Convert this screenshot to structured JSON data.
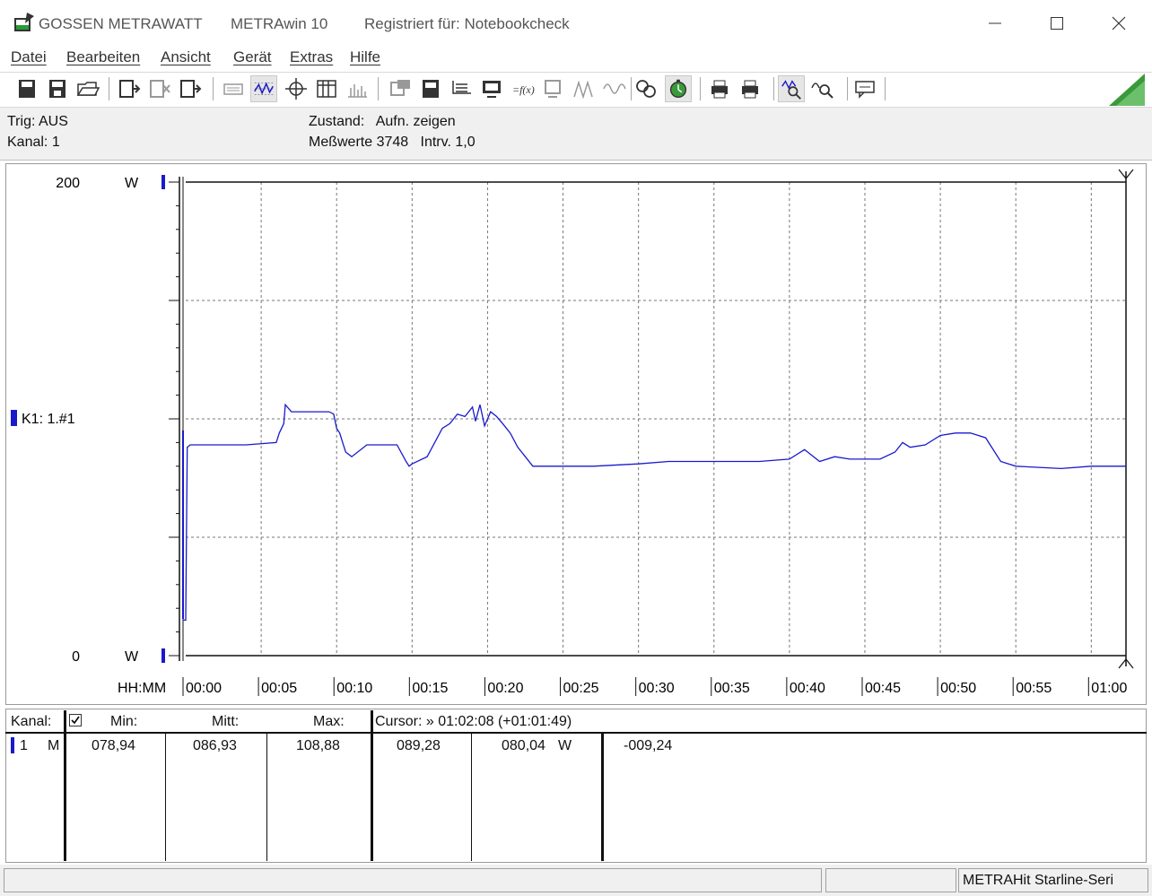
{
  "window": {
    "company": "GOSSEN METRAWATT",
    "app_name": "METRAwin 10",
    "registered": "Registriert für: Notebookcheck"
  },
  "menu": [
    "Datei",
    "Bearbeiten",
    "Ansicht",
    "Gerät",
    "Extras",
    "Hilfe"
  ],
  "toolbar_icons": [
    "save-icon",
    "save-as-icon",
    "open-folder-icon",
    "device-import-icon",
    "device-settings-icon",
    "device-export-icon",
    "keyboard-icon",
    "waveform-grid-icon",
    "crosshair-icon",
    "table-view-icon",
    "histogram-icon",
    "channel-config-icon",
    "multimeter-icon",
    "signal-list-icon",
    "monitor-icon",
    "formula-icon",
    "display-icon",
    "peak-icon",
    "sine-icon",
    "compare-icon",
    "stopwatch-icon",
    "print-preview-icon",
    "print-icon",
    "zoom-wave-icon",
    "zoom-out-icon",
    "comment-icon"
  ],
  "status": {
    "trig_label": "Trig:",
    "trig_value": "AUS",
    "kanal_label": "Kanal:",
    "kanal_value": "1",
    "zustand_label": "Zustand:",
    "zustand_value": "Aufn. zeigen",
    "messwerte_label": "Meßwerte",
    "messwerte_value": "3748",
    "intrv_label": "Intrv.",
    "intrv_value": "1,0"
  },
  "chart_data": {
    "type": "line",
    "y_top_label": "200",
    "y_top_unit": "W",
    "y_bottom_label": "0",
    "y_bottom_unit": "W",
    "channel_label": "K1: 1.#1",
    "x_axis_label": "HH:MM",
    "ylim": [
      0,
      200
    ],
    "xlim": [
      0,
      62.3
    ],
    "x_tick_labels": [
      "00:00",
      "00:05",
      "00:10",
      "00:15",
      "00:20",
      "00:25",
      "00:30",
      "00:35",
      "00:40",
      "00:45",
      "00:50",
      "00:55",
      "01:00"
    ],
    "x_ticks_minutes": [
      0,
      5,
      10,
      15,
      20,
      25,
      30,
      35,
      40,
      45,
      50,
      55,
      60
    ],
    "grid": true,
    "series": [
      {
        "color": "#1a1acc",
        "x": [
          -0.2,
          0.0,
          0.1,
          0.3,
          2,
          4,
          6,
          6.2,
          6.5,
          6.6,
          7,
          8,
          9,
          9.5,
          9.8,
          10,
          10.2,
          10.4,
          10.6,
          11,
          12,
          13,
          14,
          14.6,
          14.8,
          15,
          16,
          17,
          17.5,
          18,
          18.5,
          19,
          19.2,
          19.5,
          19.8,
          20.2,
          20.6,
          21,
          21.5,
          22,
          22.5,
          23,
          24,
          25,
          27,
          30,
          32,
          35,
          38,
          40,
          41,
          42,
          43,
          44,
          45,
          46,
          47,
          47.5,
          48,
          49,
          50,
          51,
          52,
          53,
          54,
          55,
          58,
          60,
          62.3
        ],
        "y": [
          15,
          15,
          88,
          89,
          89,
          89,
          90,
          94,
          98,
          106,
          103,
          103,
          103,
          103,
          102,
          96,
          94,
          90,
          86,
          84,
          89,
          89,
          89,
          82,
          80,
          81,
          84,
          96,
          98,
          102,
          101,
          105,
          99,
          106,
          97,
          103,
          101,
          98,
          94,
          88,
          84,
          80,
          80,
          80,
          80,
          81,
          82,
          82,
          82,
          83,
          87,
          82,
          84,
          83,
          83,
          83,
          86,
          90,
          88,
          89,
          93,
          94,
          94,
          92,
          82,
          80,
          79,
          80,
          80
        ]
      }
    ]
  },
  "table": {
    "kanal_header": "Kanal:",
    "min_header": "Min:",
    "mitt_header": "Mitt:",
    "max_header": "Max:",
    "cursor_header": "Cursor: » 01:02:08 (+01:01:49)",
    "row": {
      "channel": "1",
      "mode": "M",
      "min": "078,94",
      "mitt": "086,93",
      "max": "108,88",
      "cursor1": "089,28",
      "cursor2": "080,04",
      "unit": "W",
      "delta": "-009,24"
    }
  },
  "statusbar": {
    "device": "METRAHit Starline-Seri"
  }
}
